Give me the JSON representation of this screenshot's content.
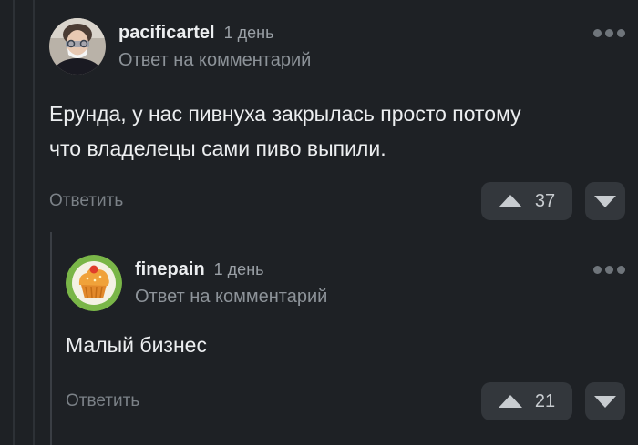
{
  "comments": [
    {
      "username": "pacificartel",
      "time": "1 день",
      "reply_to": "Ответ на комментарий",
      "text_lines": [
        "Ерунда, у нас пивнуха закрылась просто потому",
        "что владелецы сами пиво выпили."
      ],
      "reply_label": "Ответить",
      "votes": "37",
      "avatar": "avatar-person-mask"
    },
    {
      "username": "finepain",
      "time": "1 день",
      "reply_to": "Ответ на комментарий",
      "text_lines": [
        "Малый бизнес"
      ],
      "reply_label": "Ответить",
      "votes": "21",
      "avatar": "avatar-cupcake"
    }
  ],
  "colors": {
    "background": "#1e2125",
    "button_bg": "#33373c",
    "muted_text": "#8d9399",
    "cupcake_ring": "#7ab648"
  },
  "icons": [
    "more-dots-icon",
    "upvote-triangle-icon",
    "downvote-triangle-icon"
  ]
}
